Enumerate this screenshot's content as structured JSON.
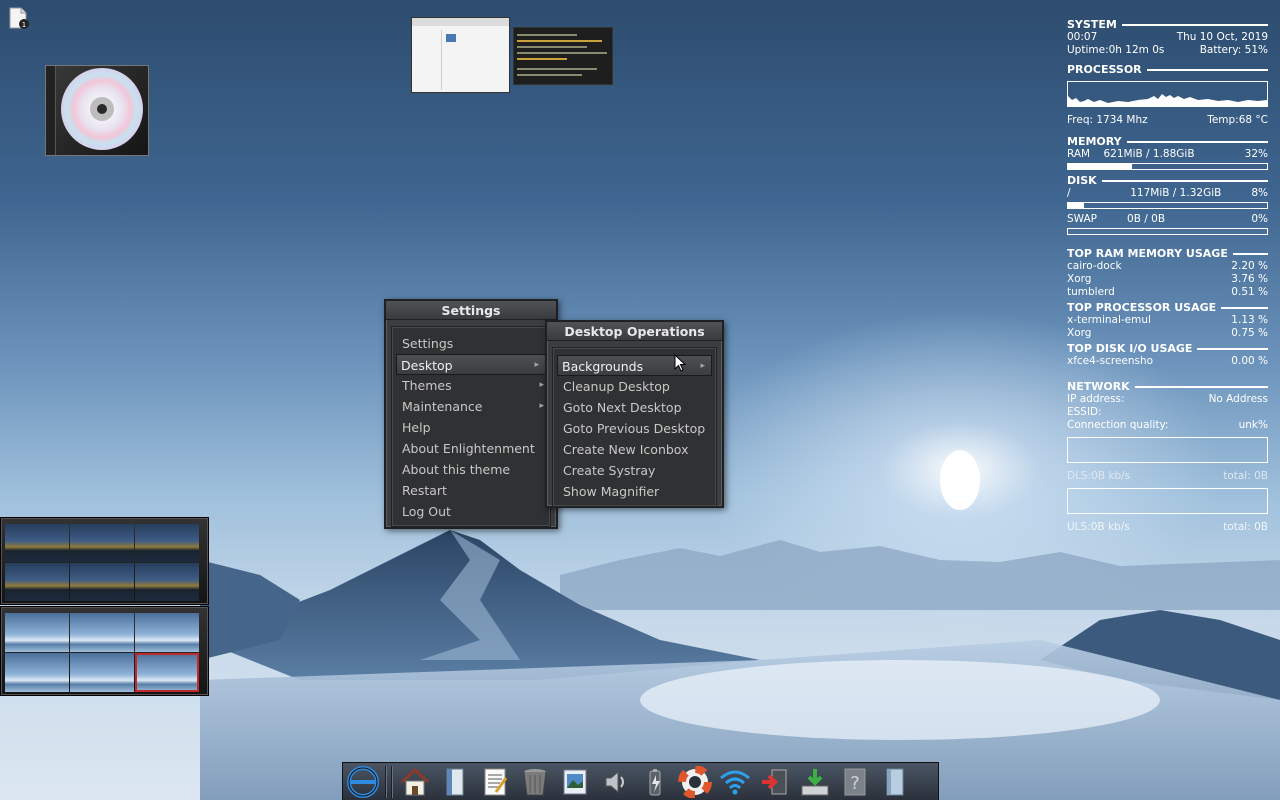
{
  "desktop": {
    "file_icon": "file-manager-icon",
    "cd_icon": "cdrom-icon"
  },
  "previews": {
    "file_manager": "file-manager-window-preview",
    "terminal": "terminal-window-preview"
  },
  "conky": {
    "system": {
      "title": "SYSTEM",
      "time": "00:07",
      "date": "Thu 10 Oct, 2019",
      "uptime": "Uptime:0h 12m 0s",
      "battery": "Battery: 51%"
    },
    "processor": {
      "title": "PROCESSOR",
      "freq": "Freq: 1734 Mhz",
      "temp": "Temp:68 °C"
    },
    "memory": {
      "title": "MEMORY",
      "ram_label": "RAM",
      "ram_value": "621MiB / 1.88GiB",
      "ram_pct": "32%",
      "ram_fraction": 0.32
    },
    "disk": {
      "title": "DISK",
      "root_label": "/",
      "root_value": "117MiB / 1.32GiB",
      "root_pct": "8%",
      "root_fraction": 0.08,
      "swap_label": "SWAP",
      "swap_value": "0B  / 0B",
      "swap_pct": "0%",
      "swap_fraction": 0
    },
    "top_ram": {
      "title": "TOP RAM MEMORY USAGE",
      "rows": [
        {
          "name": "cairo-dock",
          "value": "2.20 %"
        },
        {
          "name": "Xorg",
          "value": "3.76 %"
        },
        {
          "name": "tumblerd",
          "value": "0.51 %"
        }
      ]
    },
    "top_cpu": {
      "title": "TOP PROCESSOR USAGE",
      "rows": [
        {
          "name": "x-terminal-emul",
          "value": "1.13 %"
        },
        {
          "name": "Xorg",
          "value": "0.75 %"
        }
      ]
    },
    "top_disk": {
      "title": "TOP DISK I/O USAGE",
      "rows": [
        {
          "name": "xfce4-screensho",
          "value": "0.00 %"
        }
      ]
    },
    "network": {
      "title": "NETWORK",
      "ip_label": "IP address:",
      "ip_value": "No Address",
      "essid_label": "ESSID:",
      "quality_label": "Connection quality:",
      "quality_value": "unk%",
      "dls": "DLS:0B   kb/s",
      "dls_total": "total: 0B",
      "uls": "ULS:0B   kb/s",
      "uls_total": "total: 0B"
    }
  },
  "menus": {
    "settings": {
      "title": "Settings",
      "items": [
        {
          "label": "Settings",
          "submenu": false
        },
        {
          "label": "Desktop",
          "submenu": true
        },
        {
          "label": "Themes",
          "submenu": true
        },
        {
          "label": "Maintenance",
          "submenu": true
        },
        {
          "label": "Help",
          "submenu": false
        },
        {
          "label": "About Enlightenment",
          "submenu": false
        },
        {
          "label": "About this theme",
          "submenu": false
        },
        {
          "label": "Restart",
          "submenu": false
        },
        {
          "label": "Log Out",
          "submenu": false
        }
      ]
    },
    "desktop_operations": {
      "title": "Desktop Operations",
      "items": [
        {
          "label": "Backgrounds",
          "submenu": true
        },
        {
          "label": "Cleanup Desktop",
          "submenu": false
        },
        {
          "label": "Goto Next Desktop",
          "submenu": false
        },
        {
          "label": "Goto Previous Desktop",
          "submenu": false
        },
        {
          "label": "Create New Iconbox",
          "submenu": false
        },
        {
          "label": "Create Systray",
          "submenu": false
        },
        {
          "label": "Show Magnifier",
          "submenu": false
        }
      ]
    }
  },
  "dock": {
    "items": [
      "enlightenment-logo-icon",
      "separator",
      "separator",
      "home-icon",
      "file-manager-icon",
      "text-editor-icon",
      "trash-icon",
      "image-viewer-icon",
      "volume-icon",
      "battery-icon",
      "help-lifebuoy-icon",
      "wifi-icon",
      "logout-icon",
      "download-icon",
      "unknown-app-icon",
      "window-icon"
    ]
  },
  "colors": {
    "menu_bg": "#3b3d3f",
    "menu_text": "#c8c8c8",
    "conky_text": "#ffffff",
    "pager_selected": "#c02a2a"
  }
}
